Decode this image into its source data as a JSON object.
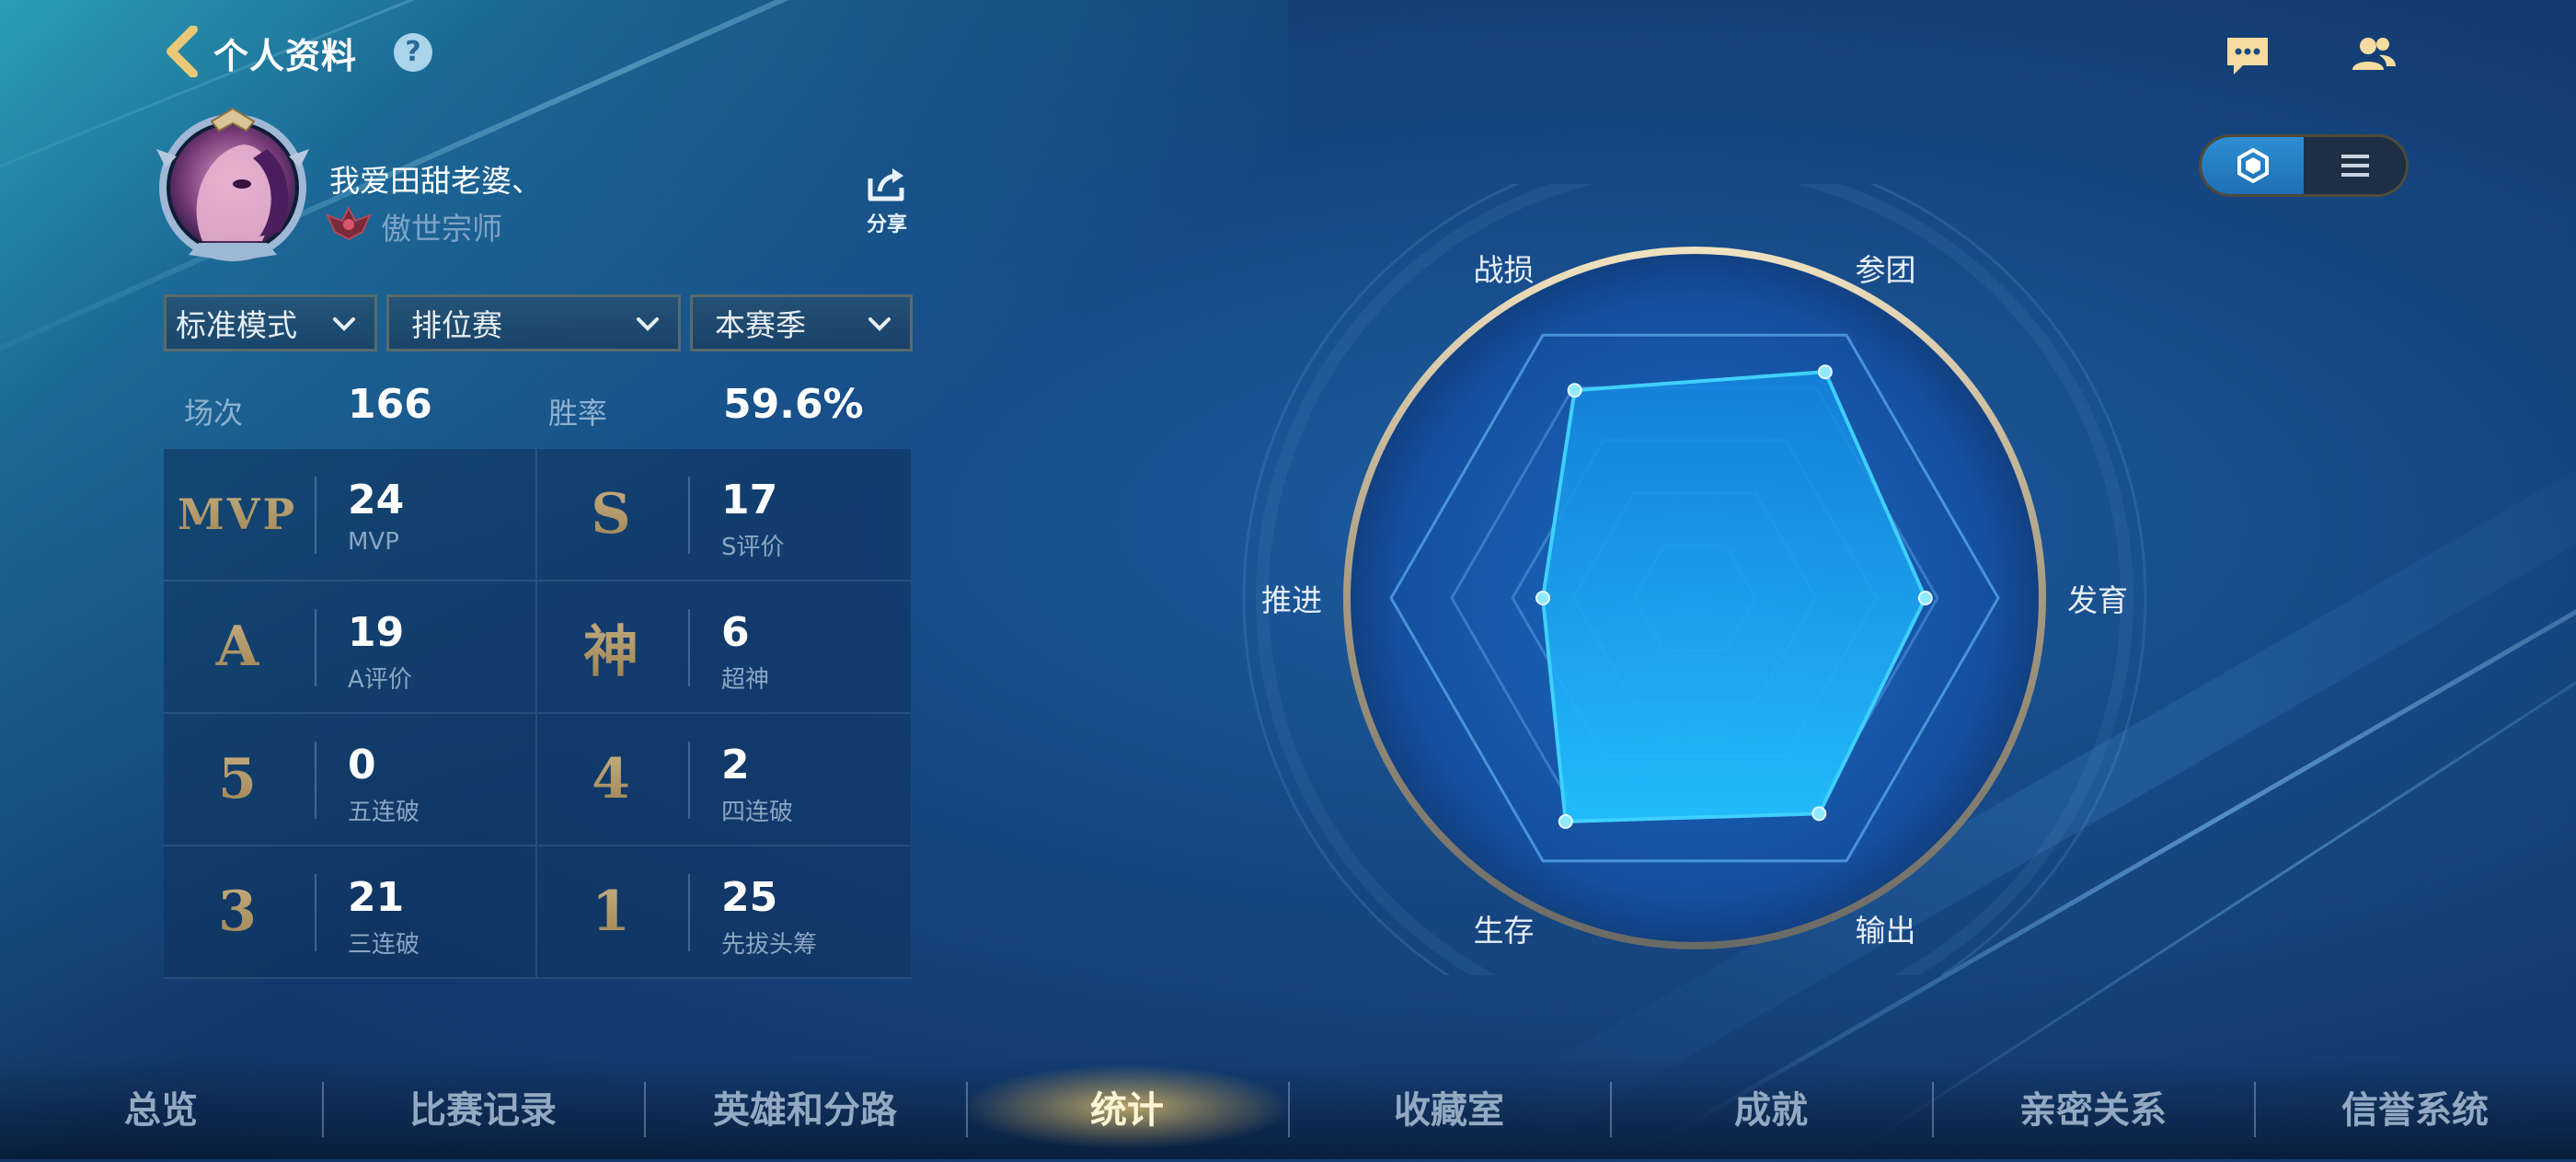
{
  "header": {
    "title": "个人资料",
    "help": "?"
  },
  "profile": {
    "name": "我爱田甜老婆、",
    "rank_title": "傲世宗师",
    "share_label": "分享"
  },
  "filters": {
    "mode": "标准模式",
    "match_type": "排位赛",
    "season": "本赛季"
  },
  "summary": {
    "games_label": "场次",
    "games_value": "166",
    "winrate_label": "胜率",
    "winrate_value": "59.6%"
  },
  "stats": [
    {
      "icon_text": "MVP",
      "value": "24",
      "label": "MVP"
    },
    {
      "icon_text": "S",
      "value": "17",
      "label": "S评价"
    },
    {
      "icon_text": "A",
      "value": "19",
      "label": "A评价"
    },
    {
      "icon_text": "神",
      "value": "6",
      "label": "超神"
    },
    {
      "icon_text": "5",
      "value": "0",
      "label": "五连破"
    },
    {
      "icon_text": "4",
      "value": "2",
      "label": "四连破"
    },
    {
      "icon_text": "3",
      "value": "21",
      "label": "三连破"
    },
    {
      "icon_text": "1",
      "value": "25",
      "label": "先拔头筹"
    }
  ],
  "radar": {
    "axes": [
      "战损",
      "参团",
      "发育",
      "输出",
      "生存",
      "推进"
    ],
    "values": [
      0.79,
      0.86,
      0.76,
      0.82,
      0.85,
      0.5
    ],
    "fill_color": "#1ea9ee",
    "line_color": "#3fd0ff"
  },
  "view_toggle": {
    "active": "radar"
  },
  "nav": {
    "tabs": [
      "总览",
      "比赛记录",
      "英雄和分路",
      "统计",
      "收藏室",
      "成就",
      "亲密关系",
      "信誉系统"
    ],
    "active_index": 3
  },
  "colors": {
    "accent_gold": "#d9c497",
    "bg_blue": "#174a87"
  },
  "icons": {
    "back": "chevron-left-icon",
    "help": "help-icon",
    "chat": "chat-icon",
    "friends": "friends-icon",
    "share": "share-icon"
  }
}
